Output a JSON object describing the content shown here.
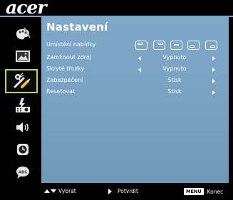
{
  "brand": {
    "logo_text": "acer"
  },
  "sidebar": {
    "tabs": [
      {
        "name": "color-tab",
        "icon": "palette-icon"
      },
      {
        "name": "image-tab",
        "icon": "picture-icon"
      },
      {
        "name": "settings-tab",
        "icon": "wrench-screwdriver-icon",
        "active": true
      },
      {
        "name": "management-tab",
        "icon": "projector-settings-icon"
      },
      {
        "name": "audio-tab",
        "icon": "speaker-icon"
      },
      {
        "name": "timer-tab",
        "icon": "clock-icon"
      },
      {
        "name": "language-tab",
        "icon": "abc-bubble-icon"
      }
    ]
  },
  "panel": {
    "title": "Nastavení",
    "rows": [
      {
        "label": "Umístění nabídky",
        "type": "positions"
      },
      {
        "label": "Zamknout zdroj",
        "value": "Vypnuto",
        "type": "select"
      },
      {
        "label": "Skryté titulky",
        "value": "Vypnuto",
        "type": "select"
      },
      {
        "label": "Zabezpečení",
        "value": "Stisk",
        "type": "enter"
      },
      {
        "label": "Resetovat",
        "value": "Stisk",
        "type": "enter"
      }
    ]
  },
  "footer": {
    "select_label": "Vybrat",
    "confirm_label": "Potvrdit",
    "menu_key": "MENU",
    "exit_label": "Konec"
  },
  "colors": {
    "panel": "#7ea7c9",
    "active_border": "#c7d52a",
    "accent_line": "#6fa6d4"
  }
}
